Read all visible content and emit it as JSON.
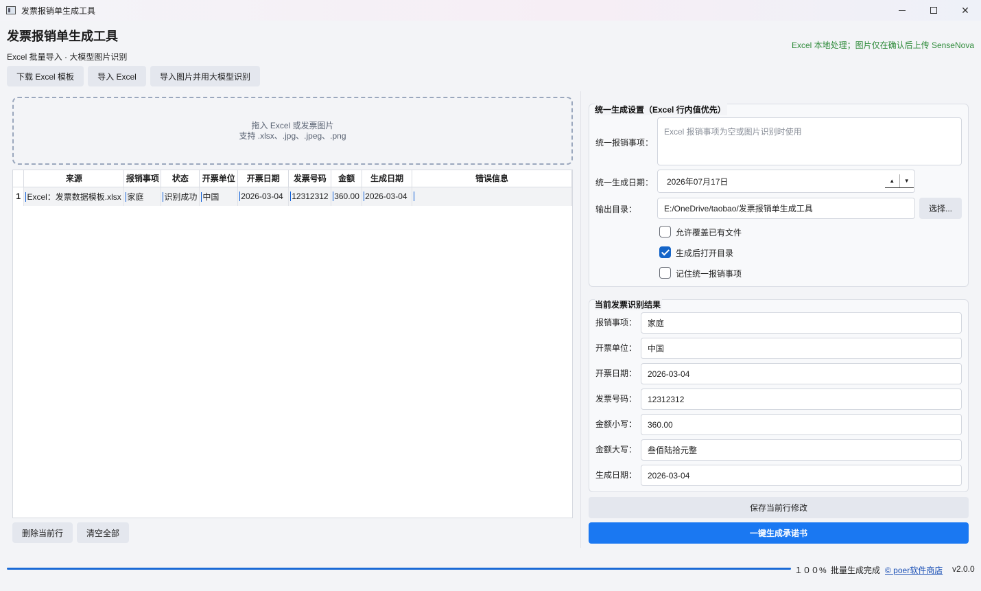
{
  "window": {
    "title": "发票报销单生成工具"
  },
  "header": {
    "title": "发票报销单生成工具",
    "subtitle": "Excel 批量导入 · 大模型图片识别",
    "note": "Excel 本地处理；图片仅在确认后上传 SenseNova",
    "note_color": "#2e8b3a"
  },
  "toolbar": {
    "download_template": "下载 Excel 模板",
    "import_excel": "导入 Excel",
    "import_images": "导入图片并用大模型识别"
  },
  "dropzone": {
    "line1": "拖入 Excel 或发票图片",
    "line2": "支持 .xlsx、.jpg、.jpeg、.png"
  },
  "table": {
    "columns": [
      "来源",
      "报销事项",
      "状态",
      "开票单位",
      "开票日期",
      "发票号码",
      "金额",
      "生成日期",
      "错误信息"
    ],
    "rows": [
      {
        "num": "1",
        "cells": [
          "Excel：发票数据模板.xlsx",
          "家庭",
          "识别成功",
          "中国",
          "2026-03-04",
          "12312312",
          "360.00",
          "2026-03-04",
          ""
        ]
      }
    ]
  },
  "left_actions": {
    "delete_row": "删除当前行",
    "clear_all": "清空全部"
  },
  "settings": {
    "title": "统一生成设置（Excel 行内值优先）",
    "matter_label": "统一报销事项：",
    "matter_placeholder": "Excel 报销事项为空或图片识别时使用",
    "date_label": "统一生成日期：",
    "date_value": "2026年07月17日",
    "output_label": "输出目录：",
    "output_value": "E:/OneDrive/taobao/发票报销单生成工具",
    "browse_button": "选择...",
    "options": [
      {
        "label": "允许覆盖已有文件",
        "checked": false
      },
      {
        "label": "生成后打开目录",
        "checked": true
      },
      {
        "label": "记住统一报销事项",
        "checked": false
      }
    ]
  },
  "result": {
    "title": "当前发票识别结果",
    "fields": [
      {
        "label": "报销事项：",
        "value": "家庭"
      },
      {
        "label": "开票单位：",
        "value": "中国"
      },
      {
        "label": "开票日期：",
        "value": "2026-03-04"
      },
      {
        "label": "发票号码：",
        "value": "12312312"
      },
      {
        "label": "金额小写：",
        "value": "360.00"
      },
      {
        "label": "金额大写：",
        "value": "叁佰陆拾元整"
      },
      {
        "label": "生成日期：",
        "value": "2026-03-04"
      }
    ]
  },
  "actions": {
    "save_row": "保存当前行修改",
    "generate": "一键生成承诺书"
  },
  "accent_color": "#1a78f2",
  "statusbar": {
    "progress": 1.0,
    "percent": "１００%",
    "message": "批量生成完成",
    "link": "© poer软件商店",
    "version": "v2.0.0"
  }
}
